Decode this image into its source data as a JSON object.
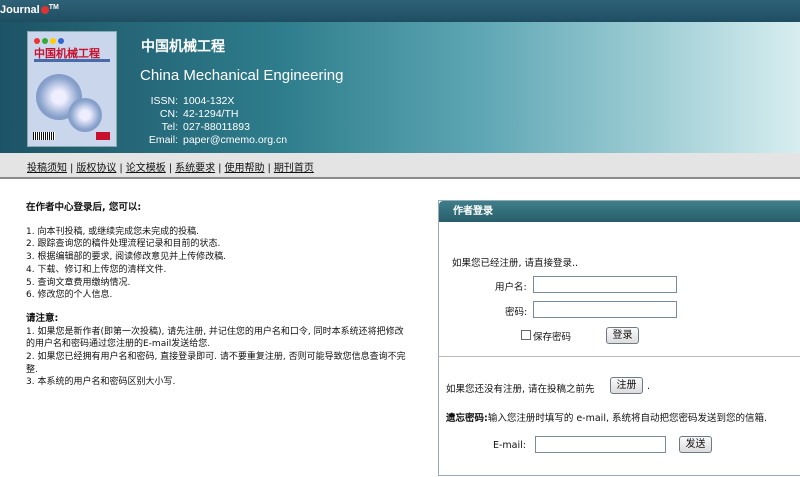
{
  "topbar": {
    "brand": "Journal",
    "tm": "TM"
  },
  "journal": {
    "title_cn": "中国机械工程",
    "title_en": "China Mechanical Engineering",
    "cover_title": "中国机械工程",
    "info": [
      {
        "label": "ISSN:",
        "value": "1004-132X"
      },
      {
        "label": "CN:",
        "value": "42-1294/TH"
      },
      {
        "label": "Tel:",
        "value": "027-88011893"
      },
      {
        "label": "Email:",
        "value": "paper@cmemo.org.cn"
      }
    ]
  },
  "nav": [
    "投稿须知",
    "版权协议",
    "论文模板",
    "系统要求",
    "使用帮助",
    "期刊首页"
  ],
  "content": {
    "heading": "在作者中心登录后, 您可以:",
    "items": [
      "1. 向本刊投稿, 或继续完成您未完成的投稿.",
      "2. 跟踪查询您的稿件处理流程记录和目前的状态.",
      "3. 根据编辑部的要求, 阅读修改意见并上传修改稿.",
      "4. 下载、修订和上传您的清样文件.",
      "5. 查询文章费用缴纳情况.",
      "6. 修改您的个人信息."
    ],
    "notice_heading": "请注意:",
    "notes": [
      "1. 如果您是新作者(即第一次投稿), 请先注册, 并记住您的用户名和口令, 同时本系统还将把修改的用户名和密码通过您注册的E-mail发送给您.",
      "2. 如果您已经拥有用户名和密码, 直接登录即可. 请不要重复注册, 否则可能导致您信息查询不完整.",
      "3. 本系统的用户名和密码区别大小写."
    ]
  },
  "login": {
    "title": "作者登录",
    "intro": "如果您已经注册, 请直接登录..",
    "username_label": "用户名:",
    "username_value": "",
    "password_label": "密码:",
    "password_value": "",
    "remember_label": "保存密码",
    "login_button": "登录",
    "register_prefix": "如果您还没有注册, 请在投稿之前先",
    "register_button": "注册",
    "register_suffix": ".",
    "forgot_label": "遗忘密码:",
    "forgot_text": "输入您注册时填写的 e-mail, 系统将自动把您密码发送到您的信箱.",
    "email_label": "E-mail:",
    "email_value": "",
    "send_button": "发送"
  }
}
